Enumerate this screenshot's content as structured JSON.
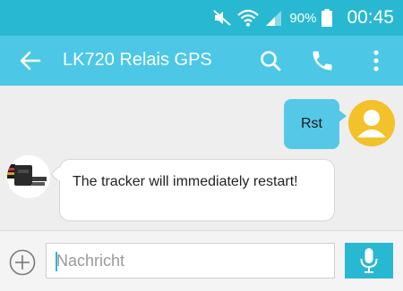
{
  "status_bar": {
    "battery_percent": "90%",
    "time": "00:45",
    "icons": [
      "mute-icon",
      "wifi-icon",
      "signal-icon",
      "battery-icon"
    ]
  },
  "app_bar": {
    "title": "LK720 Relais GPS",
    "icons": [
      "back-arrow-icon",
      "search-icon",
      "phone-icon",
      "more-vertical-icon"
    ]
  },
  "messages": [
    {
      "direction": "outgoing",
      "text": "Rst"
    },
    {
      "direction": "incoming",
      "text": "The tracker will immediately restart!"
    }
  ],
  "composer": {
    "placeholder": "Nachricht",
    "icons": [
      "add-circle-icon",
      "microphone-icon"
    ]
  },
  "colors": {
    "status_bar": "#29b8d2",
    "app_bar": "#4cc8e6",
    "outgoing_bubble": "#56c8e7",
    "incoming_bubble": "#ffffff",
    "avatar": "#f3c12a",
    "background": "#eeeeee"
  }
}
